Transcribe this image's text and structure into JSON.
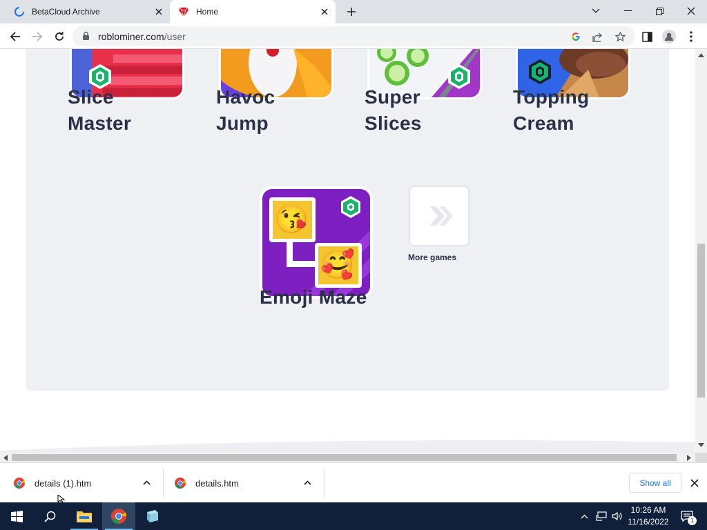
{
  "browser": {
    "tabs": [
      {
        "title": "BetaCloud Archive",
        "active": false,
        "loading": true
      },
      {
        "title": "Home",
        "active": true
      }
    ],
    "new_tab_icon": "plus-icon",
    "url_host": "roblominer.com",
    "url_path": "/user"
  },
  "page": {
    "games": [
      {
        "name_line1": "Slice",
        "name_line2": "Master"
      },
      {
        "name_line1": "Havoc",
        "name_line2": "Jump"
      },
      {
        "name_line1": "Super",
        "name_line2": "Slices"
      },
      {
        "name_line1": "Topping",
        "name_line2": "Cream"
      },
      {
        "name_line1": "Emoji Maze"
      }
    ],
    "more_games_label": "More games",
    "emoji_kiss": "😘",
    "emoji_smile": "🥰",
    "accent": "#19b36b"
  },
  "downloads": {
    "items": [
      {
        "filename": "details (1).htm"
      },
      {
        "filename": "details.htm"
      }
    ],
    "show_all": "Show all"
  },
  "taskbar": {
    "time": "10:26 AM",
    "date": "11/16/2022",
    "notification_count": "1"
  }
}
